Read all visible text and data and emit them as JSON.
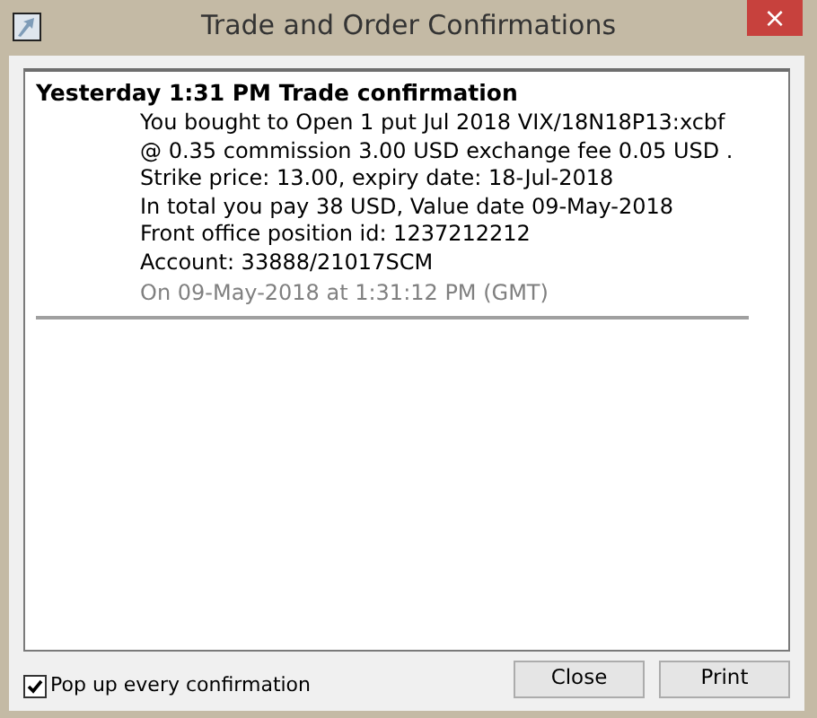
{
  "window": {
    "title": "Trade and Order Confirmations",
    "close_glyph": "×"
  },
  "messages": [
    {
      "heading": "Yesterday 1:31 PM Trade confirmation",
      "lines": [
        "You bought to Open 1 put Jul 2018 VIX/18N18P13:xcbf",
        "@ 0.35 commission 3.00 USD exchange fee 0.05 USD .",
        "Strike price: 13.00, expiry date: 18-Jul-2018",
        "In total you pay 38 USD, Value date 09-May-2018",
        "Front office position id: 1237212212",
        "Account: 33888/21017SCM"
      ],
      "timestamp": "On 09-May-2018 at 1:31:12 PM (GMT)"
    }
  ],
  "popup_checkbox": {
    "label": "Pop up every confirmation",
    "checked": true
  },
  "buttons": [
    "Close",
    "Print"
  ]
}
